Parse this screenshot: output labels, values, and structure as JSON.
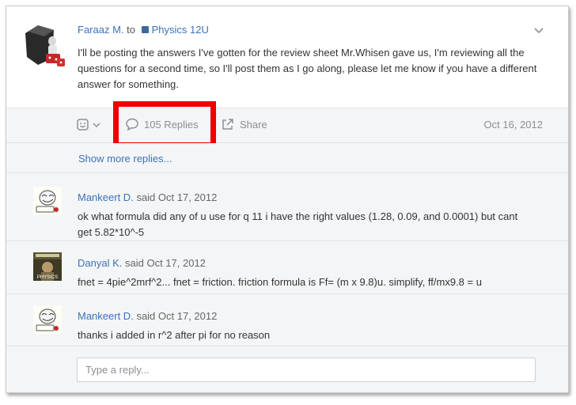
{
  "post": {
    "author": "Faraaz M.",
    "to_word": "to",
    "group": "Physics 12U",
    "body": "I'll be posting the answers I've gotten for the review sheet Mr.Whisen gave us, I'm reviewing all the questions for a second time, so I'll post them as I go along, please let me know if you have a different answer for something.",
    "date": "Oct 16, 2012",
    "avatar_icon": "dice-avatar-icon"
  },
  "actions": {
    "react_icon": "smiley-icon",
    "replies_label": "105 Replies",
    "replies_icon": "speech-bubble-icon",
    "share_label": "Share",
    "share_icon": "share-arrow-icon"
  },
  "thread": {
    "show_more": "Show more replies...",
    "replies": [
      {
        "author": "Mankeert D.",
        "meta": "said Oct 17, 2012",
        "text": "ok what formula did any of u use for q 11 i have the right values (1.28, 0.09, and 0.0001) but cant get 5.82*10^-5"
      },
      {
        "author": "Danyal K.",
        "meta": "said Oct 17, 2012",
        "text": "fnet = 4pie^2mrf^2... fnet = friction. friction formula is Ff= (m x 9.8)u. simplify, ff/mx9.8 = u",
        "avatar_caption": "PHYSICS"
      },
      {
        "author": "Mankeert D.",
        "meta": "said Oct 17, 2012",
        "text": "thanks i added in r^2 after pi for no reason"
      }
    ]
  },
  "reply_box": {
    "placeholder": "Type a reply..."
  },
  "colors": {
    "link": "#3b73b9",
    "highlight": "#ee0000",
    "muted": "#8b8f94"
  }
}
